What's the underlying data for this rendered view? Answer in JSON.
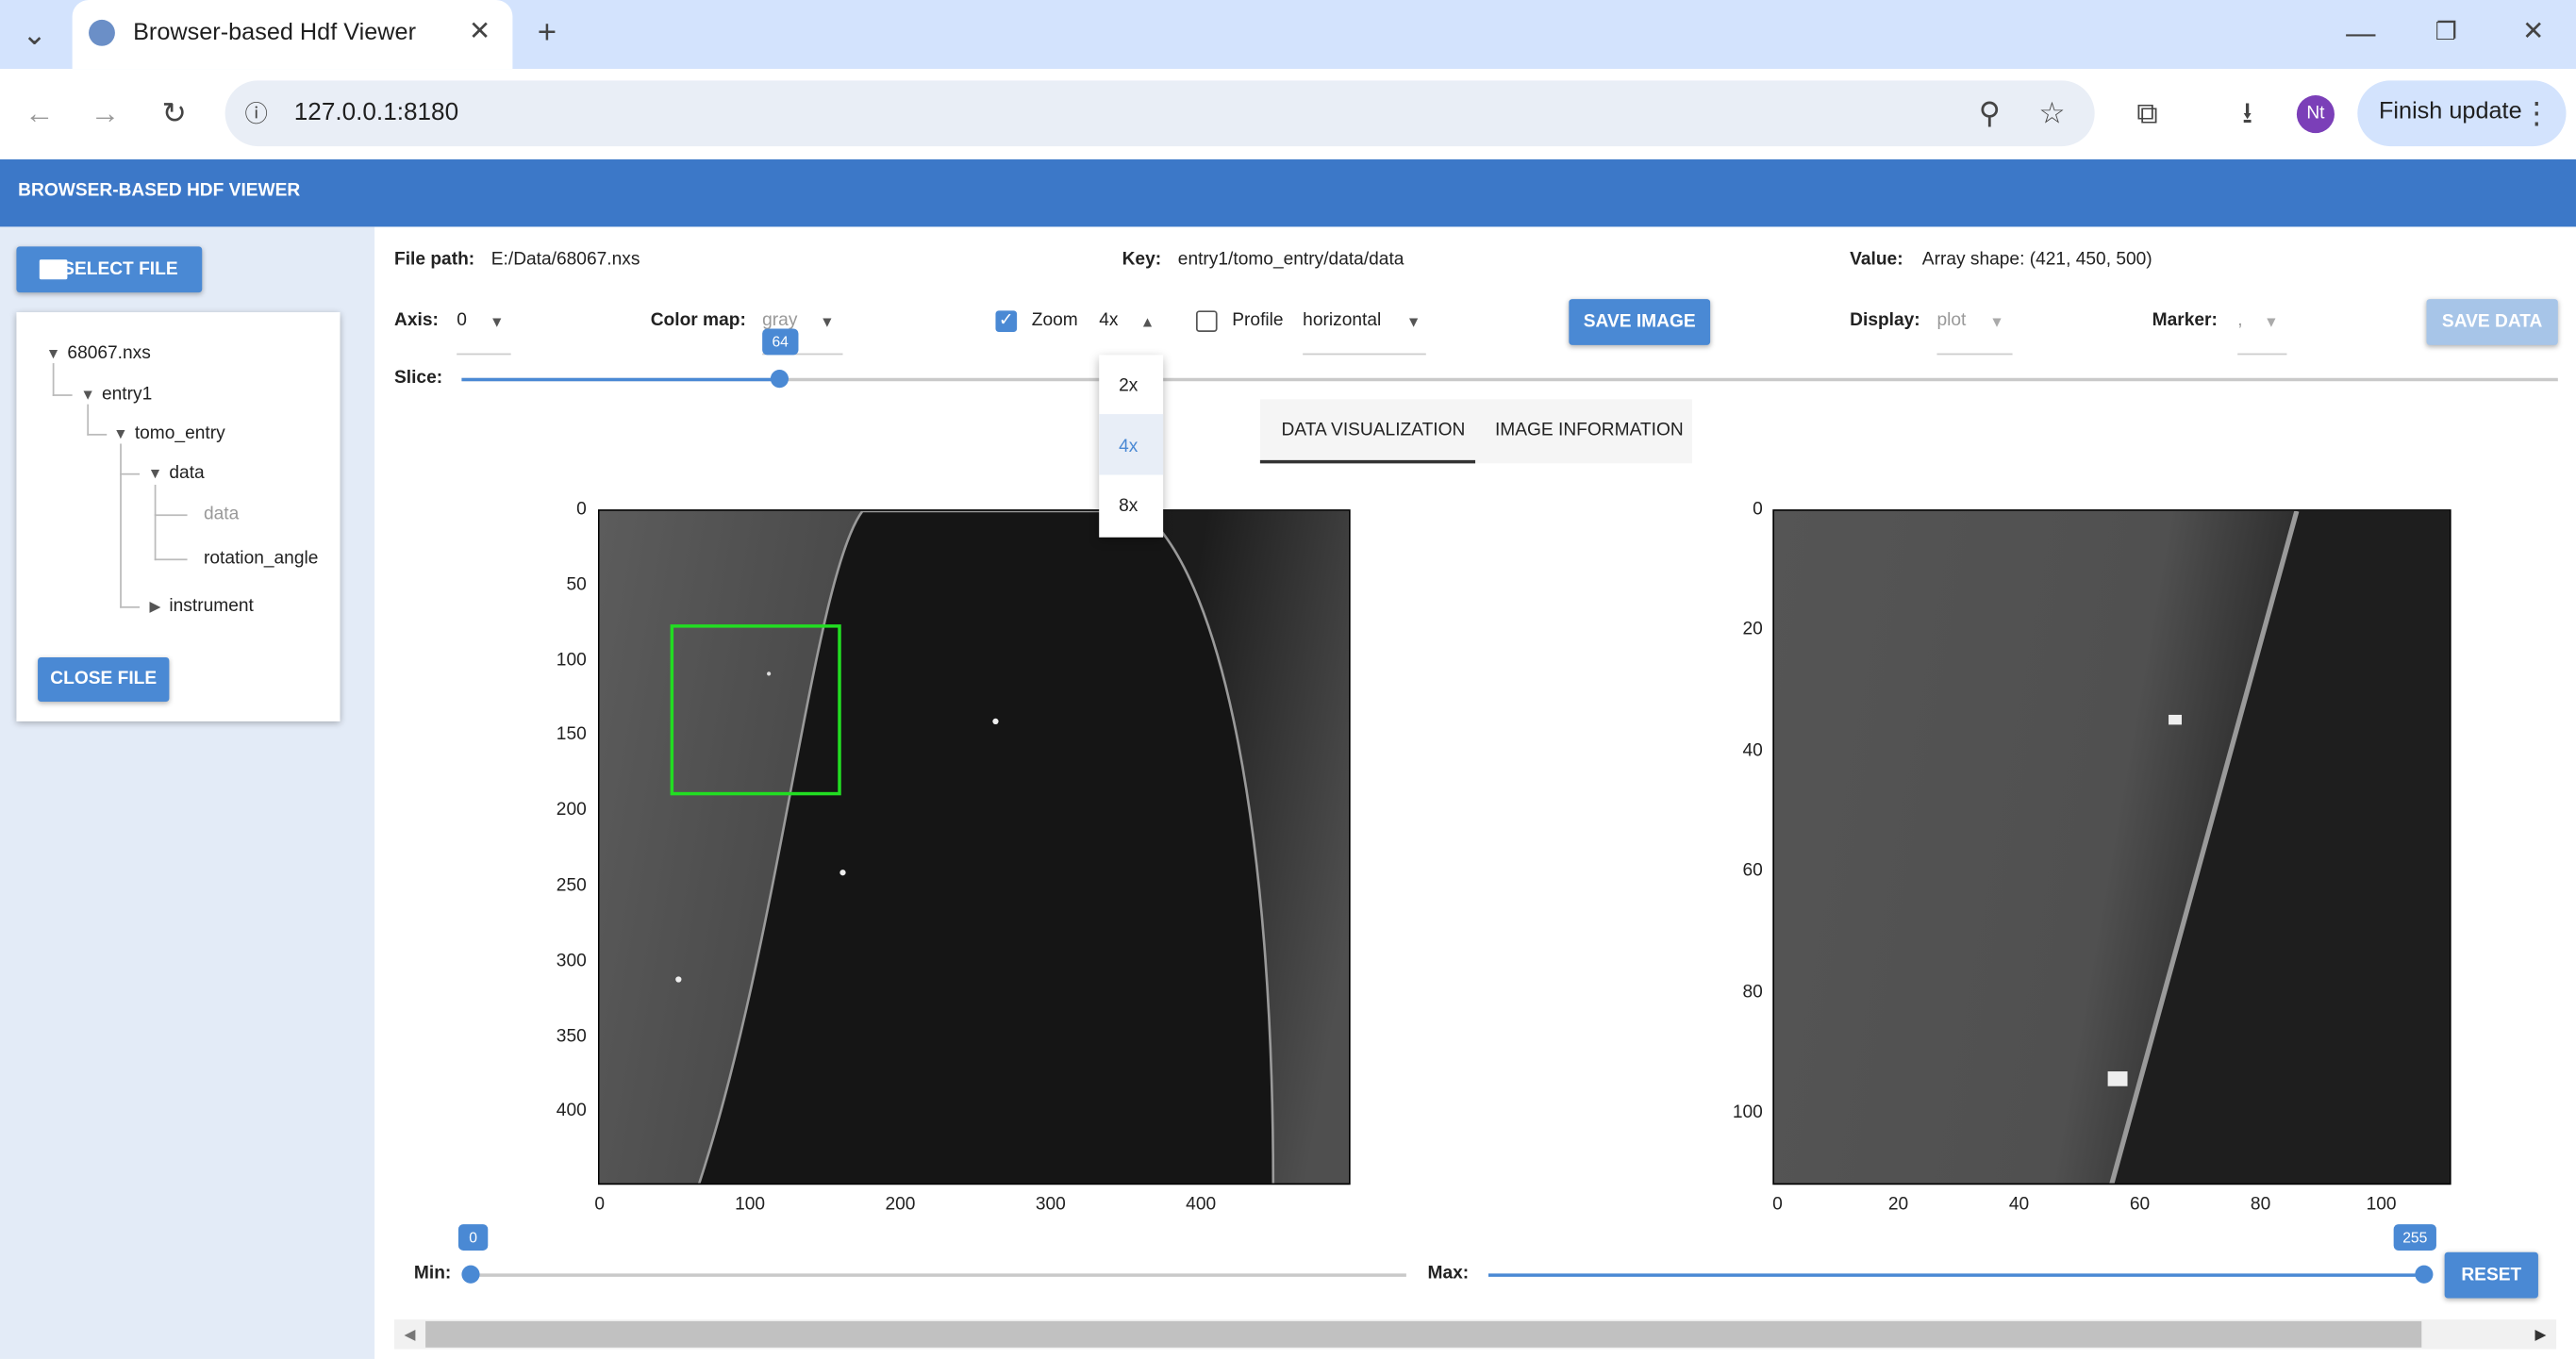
{
  "browser": {
    "tab_title": "Browser-based Hdf Viewer",
    "url": "127.0.0.1:8180",
    "finish_update": "Finish update",
    "avatar_initials": "Nt"
  },
  "app": {
    "title": "BROWSER-BASED HDF VIEWER",
    "select_file": "SELECT FILE",
    "close_file": "CLOSE FILE",
    "tree": {
      "root": "68067.nxs",
      "entry": "entry1",
      "tomo": "tomo_entry",
      "data_group": "data",
      "data_leaf": "data",
      "rotation": "rotation_angle",
      "instrument": "instrument"
    }
  },
  "info": {
    "file_path_label": "File path:",
    "file_path": "E:/Data/68067.nxs",
    "key_label": "Key:",
    "key": "entry1/tomo_entry/data/data",
    "value_label": "Value:",
    "value": "Array shape: (421, 450, 500)"
  },
  "controls": {
    "axis_label": "Axis:",
    "axis_value": "0",
    "colormap_label": "Color map:",
    "colormap_value": "gray",
    "zoom_label": "Zoom",
    "zoom_checked": true,
    "zoom_value": "4x",
    "zoom_options": [
      "2x",
      "4x",
      "8x"
    ],
    "profile_label": "Profile",
    "profile_checked": false,
    "profile_value": "horizontal",
    "save_image": "SAVE IMAGE",
    "display_label": "Display:",
    "display_value": "plot",
    "marker_label": "Marker:",
    "marker_value": ",",
    "save_data": "SAVE DATA",
    "slice_label": "Slice:",
    "slice_value": "64",
    "slice_fraction": 0.152
  },
  "tabs": {
    "visualization": "DATA VISUALIZATION",
    "image_info": "IMAGE INFORMATION"
  },
  "plots": {
    "left": {
      "yticks": [
        "0",
        "50",
        "100",
        "150",
        "200",
        "250",
        "300",
        "350",
        "400"
      ],
      "xticks": [
        "0",
        "100",
        "200",
        "300",
        "400"
      ],
      "roi_color": "#22dd22"
    },
    "right": {
      "yticks": [
        "0",
        "20",
        "40",
        "60",
        "80",
        "100"
      ],
      "xticks": [
        "0",
        "20",
        "40",
        "60",
        "80",
        "100"
      ]
    }
  },
  "range": {
    "min_label": "Min:",
    "min_value": "0",
    "max_label": "Max:",
    "max_value": "255",
    "reset": "RESET"
  },
  "colors": {
    "accent": "#4a89d4",
    "appbar": "#3c78c8",
    "sidebar": "#e3ebf7"
  }
}
